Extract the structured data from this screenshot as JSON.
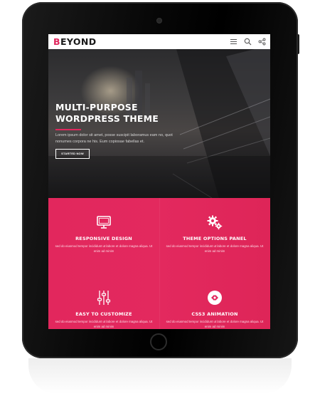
{
  "header": {
    "logo_first_letter": "B",
    "logo_rest": "EYOND",
    "icons": [
      "menu-icon",
      "search-icon",
      "share-icon"
    ]
  },
  "hero": {
    "title_line1": "MULTI-PURPOSE",
    "title_line2": "WORDPRESS THEME",
    "text": "Lorem ipsum dolor sit amet, posse suscipit laboramus eam no, quot nonumes corpora ne his. Eum copiosae fabellas et.",
    "button_label": "STARTED NOW"
  },
  "features": [
    {
      "title": "RESPONSIVE DESIGN",
      "text": "sed do eiusmod tempor incididunt ut labore et dolore magna aliqua. Ut enim ad minim",
      "icon": "monitor-icon"
    },
    {
      "title": "THEME OPTIONS PANEL",
      "text": "sed do eiusmod tempor incididunt ut labore et dolore magna aliqua. Ut enim ad minim",
      "icon": "gears-icon"
    },
    {
      "title": "EASY TO CUSTOMIZE",
      "text": "sed do eiusmod tempor incididunt ut labore et dolore magna aliqua. Ut enim ad minim",
      "icon": "sliders-icon"
    },
    {
      "title": "CSS3 ANIMATION",
      "text": "sed do eiusmod tempor incididunt ut labore et dolore magna aliqua. Ut enim ad minim",
      "icon": "css3-icon"
    }
  ],
  "colors": {
    "accent": "#e0285e",
    "header_bg": "#ffffff",
    "device_body": "#0a0a0a"
  }
}
